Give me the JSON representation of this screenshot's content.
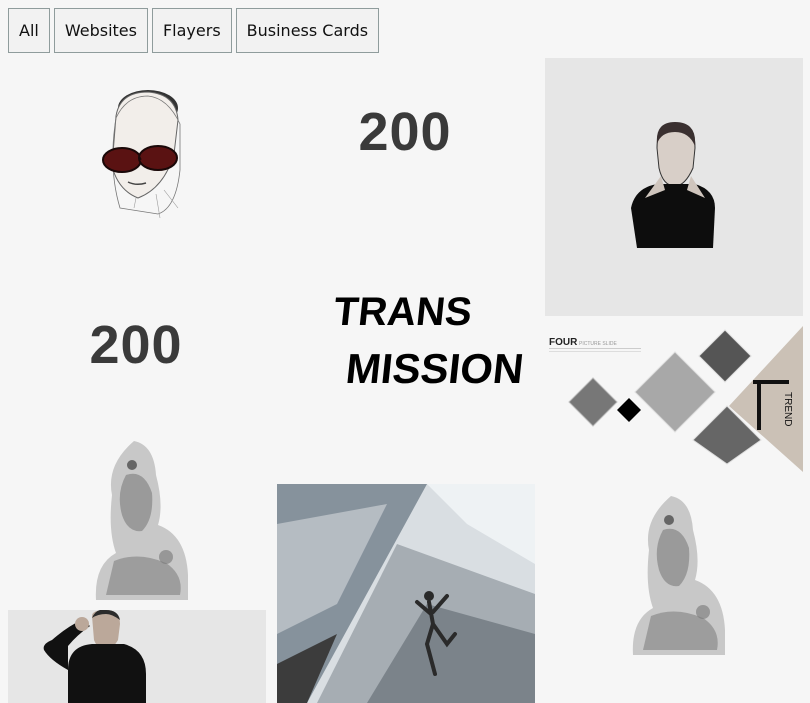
{
  "filters": {
    "all": "All",
    "websites": "Websites",
    "flayers": "Flayers",
    "business_cards": "Business Cards"
  },
  "tiles": {
    "logo_200_a": "200",
    "logo_200_b": "200",
    "transmission": {
      "line1": "TRANS",
      "line2": "MISSION"
    },
    "four": {
      "title": "FOUR",
      "subtitle": "PICTURE SLIDE",
      "side": "TREND"
    }
  }
}
